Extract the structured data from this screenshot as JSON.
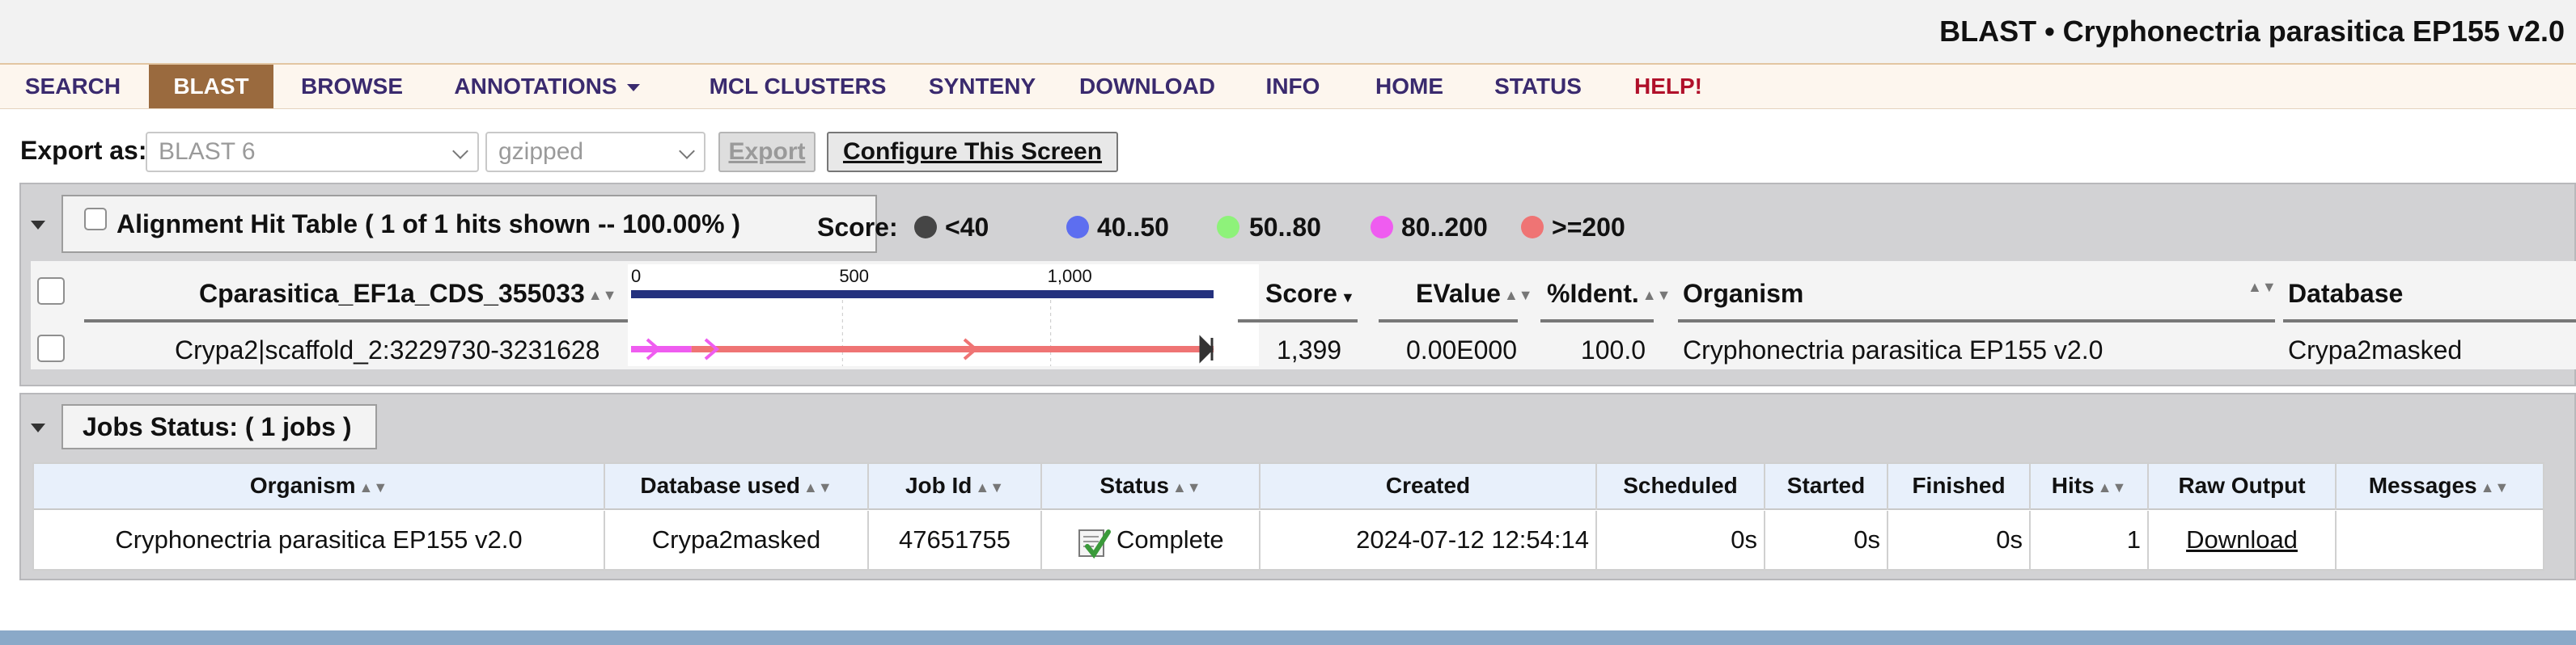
{
  "header": {
    "title": "BLAST • Cryphonectria parasitica EP155 v2.0"
  },
  "nav": {
    "items": [
      {
        "label": "SEARCH"
      },
      {
        "label": "BLAST"
      },
      {
        "label": "BROWSE"
      },
      {
        "label": "ANNOTATIONS"
      },
      {
        "label": "MCL CLUSTERS"
      },
      {
        "label": "SYNTENY"
      },
      {
        "label": "DOWNLOAD"
      },
      {
        "label": "INFO"
      },
      {
        "label": "HOME"
      },
      {
        "label": "STATUS"
      },
      {
        "label": "HELP!"
      }
    ],
    "active": "BLAST"
  },
  "export": {
    "label": "Export as:",
    "format_value": "BLAST 6",
    "compression_value": "gzipped",
    "export_button": "Export",
    "configure_button": "Configure This Screen"
  },
  "alignment": {
    "title": "Alignment Hit Table ( 1  of 1  hits shown -- 100.00%  )",
    "score_label": "Score:",
    "legend": [
      {
        "label": "<40",
        "color": "#454545"
      },
      {
        "label": "40..50",
        "color": "#5d6ef0"
      },
      {
        "label": "50..80",
        "color": "#8ef27a"
      },
      {
        "label": "80..200",
        "color": "#ef5cf0"
      },
      {
        "label": ">=200",
        "color": "#ef7474"
      }
    ],
    "columns": {
      "query": "Cparasitica_EF1a_CDS_355033",
      "score": "Score",
      "evalue": "EValue",
      "ident": "%Ident.",
      "organism": "Organism",
      "database": "Database"
    },
    "ruler": {
      "ticks": [
        "0",
        "500",
        "1,000"
      ],
      "max": 1399
    },
    "rows": [
      {
        "hit": "Crypa2|scaffold_2:3229730-3231628",
        "score": "1,399",
        "evalue": "0.00E000",
        "ident": "100.0",
        "organism": "Cryphonectria parasitica EP155 v2.0",
        "database": "Crypa2masked"
      }
    ]
  },
  "jobs": {
    "title": "Jobs Status: ( 1  jobs )",
    "columns": [
      "Organism",
      "Database used",
      "Job Id",
      "Status",
      "Created",
      "Scheduled",
      "Started",
      "Finished",
      "Hits",
      "Raw Output",
      "Messages"
    ],
    "rows": [
      {
        "organism": "Cryphonectria parasitica EP155 v2.0",
        "database": "Crypa2masked",
        "job_id": "47651755",
        "status": "Complete",
        "created": "2024-07-12 12:54:14",
        "scheduled": "0s",
        "started": "0s",
        "finished": "0s",
        "hits": "1",
        "raw_output": "Download",
        "messages": ""
      }
    ]
  },
  "icons": [
    "chevron-down-icon",
    "collapse-toggle-icon",
    "sort-icon",
    "status-complete-icon"
  ]
}
